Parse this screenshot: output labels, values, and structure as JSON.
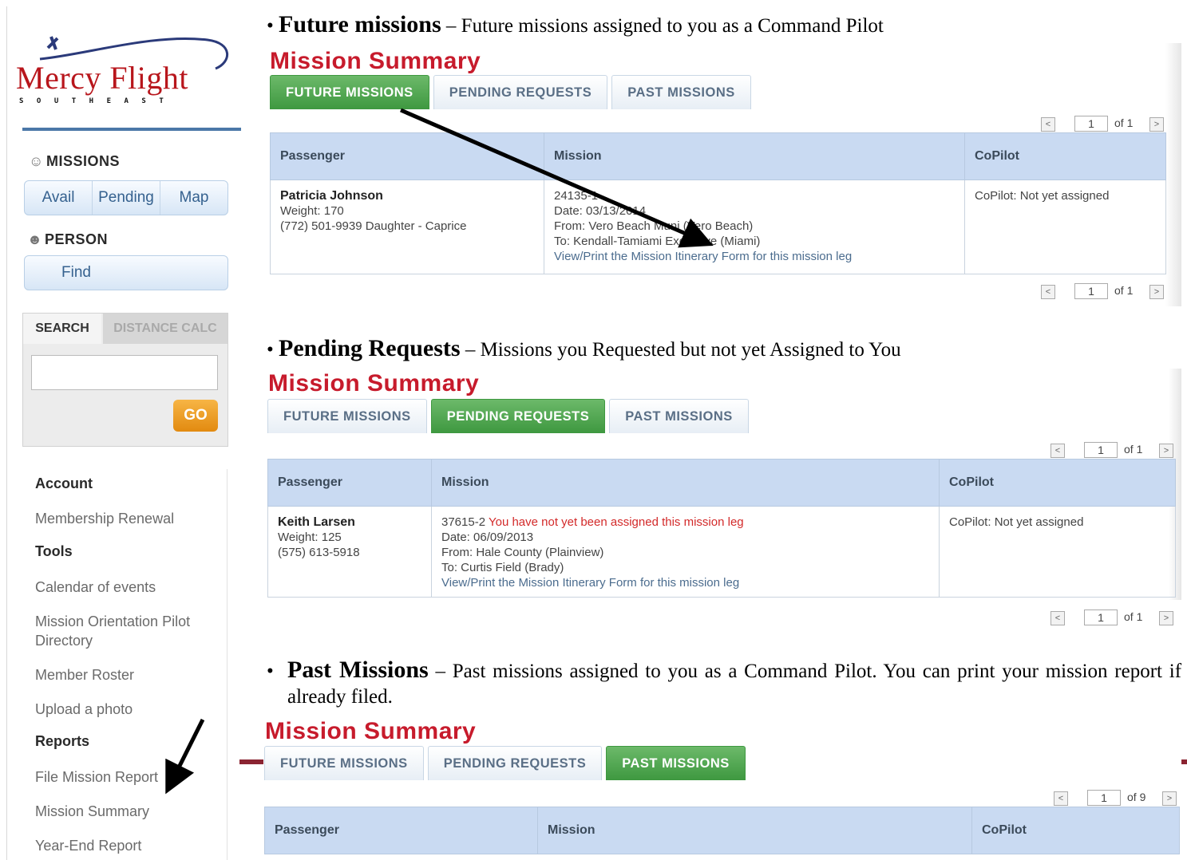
{
  "sidebar": {
    "logo_text": "Mercy Flight",
    "logo_sub": "SOUTHEAST",
    "missions_head": "MISSIONS",
    "missions_buttons": [
      "Avail",
      "Pending",
      "Map"
    ],
    "person_head": "PERSON",
    "find_label": "Find",
    "search_tab": "SEARCH",
    "distance_tab": "DISTANCE CALC",
    "go_label": "GO",
    "links": {
      "account": "Account",
      "membership_renewal": "Membership Renewal",
      "tools": "Tools",
      "calendar": "Calendar of events",
      "orientation": "Mission Orientation Pilot Directory",
      "roster": "Member Roster",
      "upload": "Upload a photo",
      "reports": "Reports",
      "file_report": "File Mission Report",
      "mission_summary": "Mission Summary",
      "year_end": "Year-End Report"
    }
  },
  "sections": {
    "future": {
      "bullet_head": "Future missions",
      "bullet_text": "– Future missions assigned to you as a Command Pilot"
    },
    "pending": {
      "bullet_head": "Pending Requests",
      "bullet_text": "– Missions you Requested but not yet Assigned to You"
    },
    "past": {
      "bullet_head": "Past Missions",
      "bullet_text": "– Past missions assigned to you as a Command Pilot. You can print your mission report if already filed."
    }
  },
  "summary": {
    "title": "Mission Summary",
    "tabs": [
      "FUTURE MISSIONS",
      "PENDING REQUESTS",
      "PAST MISSIONS"
    ],
    "columns": [
      "Passenger",
      "Mission",
      "CoPilot"
    ]
  },
  "pager": {
    "page": "1",
    "future_of": "of 1",
    "pending_of": "of 1",
    "past_of": "of 9"
  },
  "future_row": {
    "name": "Patricia Johnson",
    "weight": "Weight: 170",
    "phone": "(772) 501-9939 Daughter - Caprice",
    "mission_id": "24135-1",
    "date": "Date: 03/13/2014",
    "from": "From: Vero Beach Muni (Vero Beach)",
    "to": "To: Kendall-Tamiami Executive (Miami)",
    "itinerary": "View/Print the Mission Itinerary Form for this mission leg",
    "copilot": "CoPilot: Not yet assigned"
  },
  "pending_row": {
    "name": "Keith Larsen",
    "weight": "Weight: 125",
    "phone": "(575) 613-5918",
    "mission_id": "37615-2",
    "status": "You have not yet been assigned this mission leg",
    "date": "Date: 06/09/2013",
    "from": "From: Hale County (Plainview)",
    "to": "To: Curtis Field (Brady)",
    "itinerary": "View/Print the Mission Itinerary Form for this mission leg",
    "copilot": "CoPilot: Not yet assigned"
  },
  "colors": {
    "accent_red": "#c71b2c",
    "active_tab": "#4ea64e",
    "header_blue": "#c9daf2"
  }
}
